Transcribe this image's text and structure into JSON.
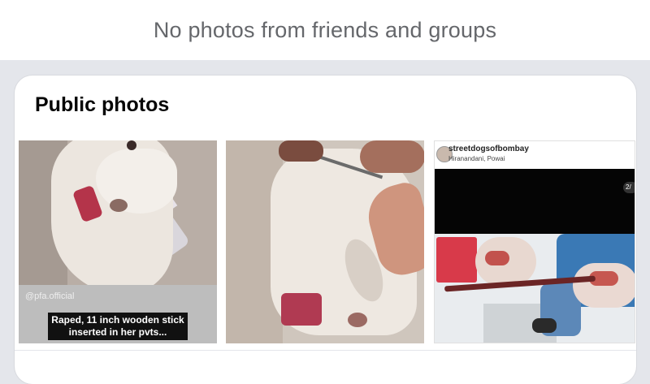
{
  "banner": {
    "text": "No photos from friends and groups"
  },
  "public_photos": {
    "title": "Public photos",
    "photos": [
      {
        "watermark": "@pfa.official",
        "caption_line1": "Raped, 11 inch wooden stick",
        "caption_line2": "inserted in her pvts..."
      },
      {},
      {
        "username": "streetdogsofbombay",
        "location": "Hiranandani, Powai",
        "counter": "2/"
      }
    ]
  }
}
